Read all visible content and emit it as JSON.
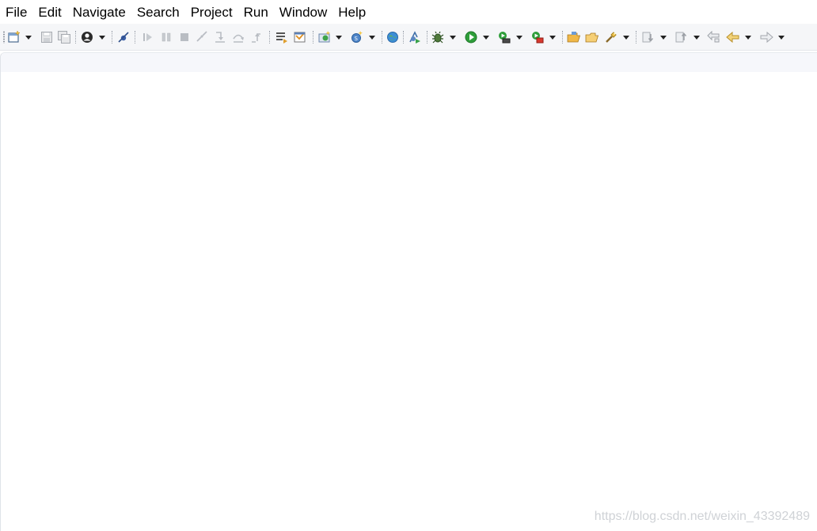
{
  "menubar": {
    "items": [
      {
        "label": "File"
      },
      {
        "label": "Edit"
      },
      {
        "label": "Navigate"
      },
      {
        "label": "Search"
      },
      {
        "label": "Project"
      },
      {
        "label": "Run"
      },
      {
        "label": "Window"
      },
      {
        "label": "Help"
      }
    ]
  },
  "toolbar": {
    "icons": [
      "new-icon",
      "save-icon",
      "save-all-icon",
      "publish-icon",
      "skip-breakpoints-icon",
      "resume-icon",
      "suspend-icon",
      "terminate-icon",
      "disconnect-icon",
      "step-into-icon",
      "step-over-icon",
      "step-return-icon",
      "open-type-icon",
      "open-task-icon",
      "new-server-icon",
      "new-web-service-icon",
      "browser-icon",
      "deploy-icon",
      "debug-icon",
      "run-icon",
      "run-server-icon",
      "external-tools-icon",
      "open-folder-icon",
      "open-file-icon",
      "search-icon",
      "next-annotation-icon",
      "previous-annotation-icon",
      "last-edit-location-icon",
      "back-icon",
      "forward-icon"
    ]
  },
  "colors": {
    "toolbar_bg": "#f5f6f8",
    "accent_green": "#2e9e3a",
    "accent_yellow": "#e8b24a",
    "accent_blue": "#3b6fb6"
  },
  "watermark": {
    "text": "https://blog.csdn.net/weixin_43392489"
  }
}
